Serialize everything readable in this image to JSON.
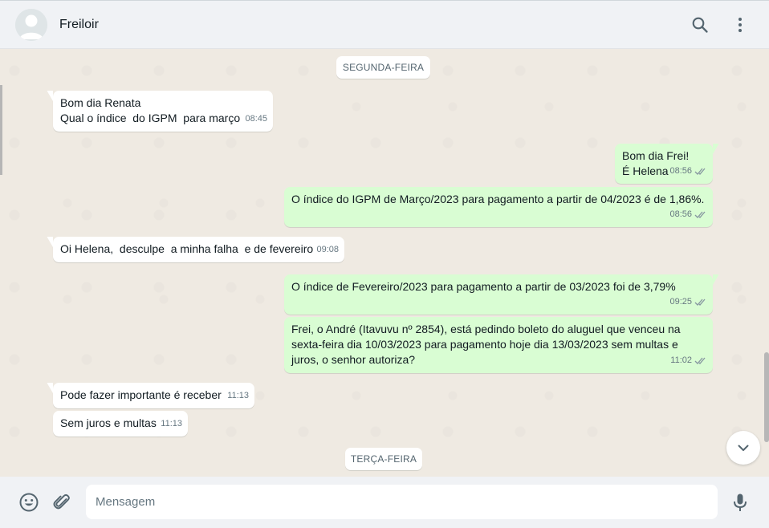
{
  "header": {
    "contact_name": "Freiloir"
  },
  "days": {
    "first": "SEGUNDA-FEIRA",
    "second": "TERÇA-FEIRA"
  },
  "messages": [
    {
      "dir": "in",
      "text": "Bom dia Renata\nQual o índice  do IGPM  para março",
      "time": "08:45"
    },
    {
      "dir": "out",
      "text": "Bom dia Frei!\nÉ Helena",
      "time": "08:56",
      "ticks": "read"
    },
    {
      "dir": "out",
      "text": "O índice do IGPM de Março/2023 para pagamento a partir de 04/2023 é de 1,86%.",
      "time": "08:56",
      "ticks": "read"
    },
    {
      "dir": "in",
      "text": "Oi Helena,  desculpe  a minha falha  e de fevereiro",
      "time": "09:08"
    },
    {
      "dir": "out",
      "text": "O índice de Fevereiro/2023 para pagamento a partir de 03/2023 foi de 3,79%",
      "time": "09:25",
      "ticks": "read"
    },
    {
      "dir": "out",
      "text": "Frei, o André (Itavuvu nº 2854), está pedindo boleto do aluguel que venceu na\nsexta-feira dia 10/03/2023 para pagamento hoje dia 13/03/2023 sem multas e\njuros, o senhor autoriza?",
      "time": "11:02",
      "ticks": "read"
    },
    {
      "dir": "in",
      "text": "Pode fazer importante é receber",
      "time": "11:13"
    },
    {
      "dir": "in",
      "text": "Sem juros e multas",
      "time": "11:13"
    }
  ],
  "composer": {
    "placeholder": "Mensagem"
  },
  "colors": {
    "outgoing_bubble": "#d9fdd3",
    "incoming_bubble": "#ffffff",
    "chat_background": "#efeae2",
    "header_background": "#f0f2f5",
    "read_ticks": "#8696a0"
  },
  "icons": [
    "avatar-placeholder",
    "search-icon",
    "menu-dots-icon",
    "chevron-down-icon",
    "emoji-icon",
    "attach-icon",
    "mic-icon",
    "double-check-icon"
  ]
}
